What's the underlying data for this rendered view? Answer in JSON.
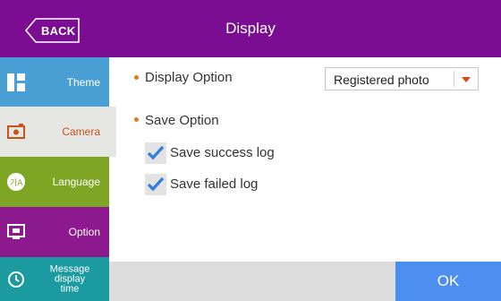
{
  "header": {
    "back_label": "BACK",
    "title": "Display"
  },
  "sidebar": {
    "items": [
      {
        "label": "Theme",
        "icon": "theme-icon"
      },
      {
        "label": "Camera",
        "icon": "camera-icon",
        "selected": true
      },
      {
        "label": "Language",
        "icon": "language-icon"
      },
      {
        "label": "Option",
        "icon": "monitor-icon"
      },
      {
        "label_lines": [
          "Message",
          "display",
          "time"
        ],
        "icon": "clock-icon"
      }
    ]
  },
  "main": {
    "display_option": {
      "label": "Display Option",
      "selected_value": "Registered photo"
    },
    "save_option": {
      "label": "Save Option",
      "checks": [
        {
          "label": "Save success log",
          "checked": true
        },
        {
          "label": "Save failed log",
          "checked": true
        }
      ]
    }
  },
  "footer": {
    "ok_label": "OK"
  },
  "colors": {
    "header": "#7a0d91",
    "theme": "#4aa0d4",
    "camera": "#e6e6e2",
    "language": "#7fa524",
    "option": "#8c1a8e",
    "message": "#1b9aa0",
    "ok": "#4d8ff0",
    "accent": "#e0441c"
  }
}
